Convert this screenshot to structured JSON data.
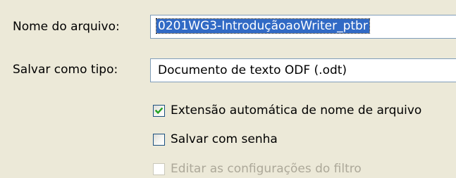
{
  "filename": {
    "label": "Nome do arquivo:",
    "value": "0201WG3-IntroduçãoaoWriter_ptbr"
  },
  "filetype": {
    "label": "Salvar como tipo:",
    "value": "Documento de texto ODF (.odt)"
  },
  "options": {
    "auto_extension": {
      "label": "Extensão automática de nome de arquivo",
      "checked": true,
      "enabled": true
    },
    "save_password": {
      "label": "Salvar com senha",
      "checked": false,
      "enabled": true
    },
    "edit_filter": {
      "label": "Editar as configurações do filtro",
      "checked": false,
      "enabled": false
    }
  },
  "colors": {
    "dialog_bg": "#ece9d8",
    "field_border": "#7f9db9",
    "selection_bg": "#316ac5",
    "checkmark": "#21a121",
    "disabled_text": "#aca899"
  },
  "icons": {
    "checked": "checkmark-icon"
  }
}
